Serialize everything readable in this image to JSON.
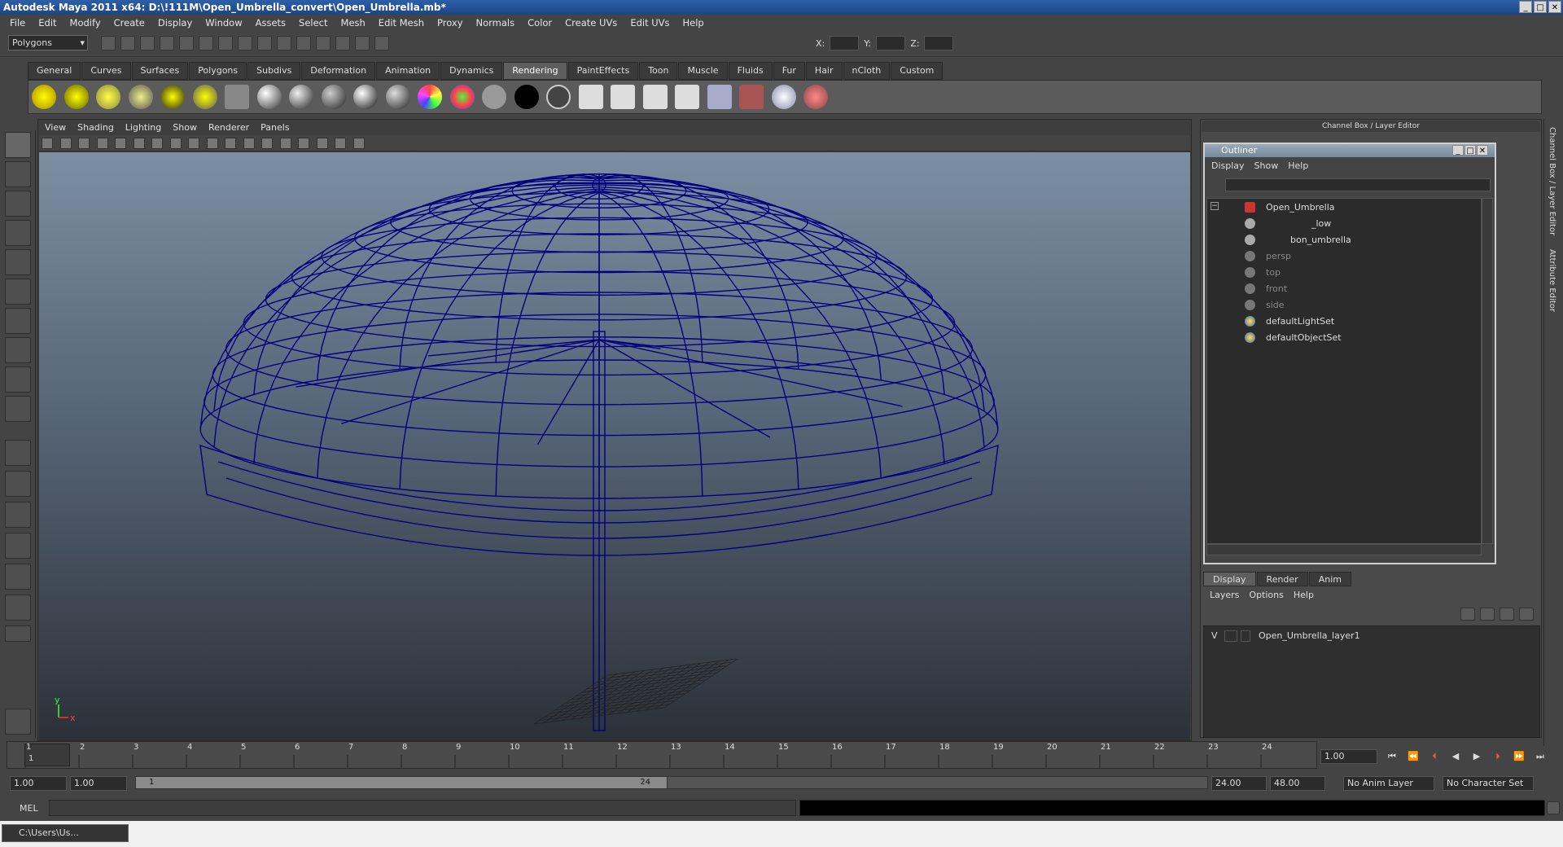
{
  "app": {
    "title": "Autodesk Maya 2011 x64: D:\\!111M\\Open_Umbrella_convert\\Open_Umbrella.mb*"
  },
  "menubar": [
    "File",
    "Edit",
    "Modify",
    "Create",
    "Display",
    "Window",
    "Assets",
    "Select",
    "Mesh",
    "Edit Mesh",
    "Proxy",
    "Normals",
    "Color",
    "Create UVs",
    "Edit UVs",
    "Help"
  ],
  "statusline": {
    "mode": "Polygons",
    "x_label": "X:",
    "y_label": "Y:",
    "z_label": "Z:"
  },
  "shelf": {
    "tabs": [
      "General",
      "Curves",
      "Surfaces",
      "Polygons",
      "Subdivs",
      "Deformation",
      "Animation",
      "Dynamics",
      "Rendering",
      "PaintEffects",
      "Toon",
      "Muscle",
      "Fluids",
      "Fur",
      "Hair",
      "nCloth",
      "Custom"
    ],
    "active": "Rendering"
  },
  "viewport": {
    "menu": [
      "View",
      "Shading",
      "Lighting",
      "Show",
      "Renderer",
      "Panels"
    ],
    "axis_y": "y",
    "axis_x": "x",
    "wire_color": "#000080"
  },
  "channel_box": {
    "title": "Channel Box / Layer Editor"
  },
  "outliner": {
    "title": "Outliner",
    "menu": [
      "Display",
      "Show",
      "Help"
    ],
    "items": [
      {
        "label": "Open_Umbrella",
        "dim": false
      },
      {
        "label": "_low",
        "dim": false
      },
      {
        "label": "bon_umbrella",
        "dim": false
      },
      {
        "label": "persp",
        "dim": true
      },
      {
        "label": "top",
        "dim": true
      },
      {
        "label": "front",
        "dim": true
      },
      {
        "label": "side",
        "dim": true
      },
      {
        "label": "defaultLightSet",
        "dim": false
      },
      {
        "label": "defaultObjectSet",
        "dim": false
      }
    ]
  },
  "layer_editor": {
    "tabs": [
      "Display",
      "Render",
      "Anim"
    ],
    "active_tab": "Display",
    "menu": [
      "Layers",
      "Options",
      "Help"
    ],
    "layer": {
      "visibility": "V",
      "name": "Open_Umbrella_layer1"
    }
  },
  "side_tabs": [
    "Channel Box / Layer Editor",
    "Attribute Editor"
  ],
  "timeline": {
    "ticks": [
      "1",
      "2",
      "3",
      "4",
      "5",
      "6",
      "7",
      "8",
      "9",
      "10",
      "11",
      "12",
      "13",
      "14",
      "15",
      "16",
      "17",
      "18",
      "19",
      "20",
      "21",
      "22",
      "23",
      "24"
    ],
    "current_frame_marker": "1",
    "current_time": "1.00"
  },
  "range": {
    "start": "1.00",
    "range_start": "1.00",
    "slider_start": "1",
    "slider_end": "24",
    "range_end": "24.00",
    "end": "48.00",
    "anim_layer": "No Anim Layer",
    "character_set": "No Character Set"
  },
  "command_line": {
    "label": "MEL"
  },
  "taskbar": {
    "item": "C:\\Users\\Us..."
  }
}
